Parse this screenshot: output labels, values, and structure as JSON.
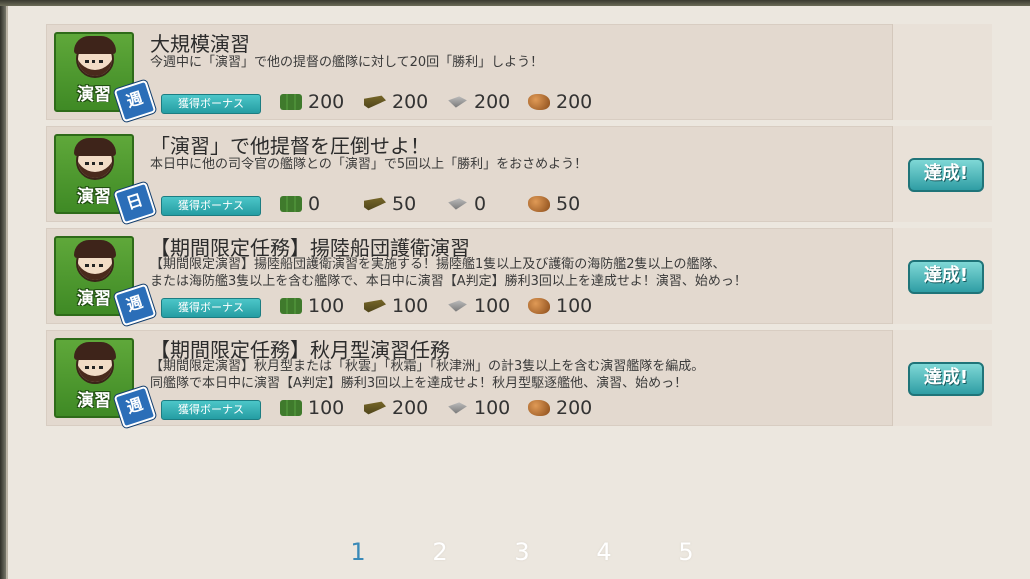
{
  "quests": [
    {
      "badge_label": "演習",
      "frequency": "週",
      "title": "大規模演習",
      "desc": [
        "今週中に「演習」で他の提督の艦隊に対して20回「勝利」しよう！"
      ],
      "bonus_label": "獲得ボーナス",
      "rewards": {
        "fuel": "200",
        "ammo": "200",
        "steel": "200",
        "bauxite": "200"
      },
      "status": ""
    },
    {
      "badge_label": "演習",
      "frequency": "日",
      "title": "「演習」で他提督を圧倒せよ！",
      "desc": [
        "本日中に他の司令官の艦隊との「演習」で5回以上「勝利」をおさめよう！"
      ],
      "bonus_label": "獲得ボーナス",
      "rewards": {
        "fuel": "0",
        "ammo": "50",
        "steel": "0",
        "bauxite": "50"
      },
      "status": "達成!"
    },
    {
      "badge_label": "演習",
      "frequency": "週",
      "title": "【期間限定任務】揚陸船団護衛演習",
      "desc": [
        "【期間限定演習】揚陸船団護衛演習を実施する！揚陸艦1隻以上及び護衛の海防艦2隻以上の艦隊、",
        "または海防艦3隻以上を含む艦隊で、本日中に演習【A判定】勝利3回以上を達成せよ！演習、始めっ！"
      ],
      "bonus_label": "獲得ボーナス",
      "rewards": {
        "fuel": "100",
        "ammo": "100",
        "steel": "100",
        "bauxite": "100"
      },
      "status": "達成!"
    },
    {
      "badge_label": "演習",
      "frequency": "週",
      "title": "【期間限定任務】秋月型演習任務",
      "desc": [
        "【期間限定演習】秋月型または「秋雲」「秋霜」「秋津洲」の計3隻以上を含む演習艦隊を編成。",
        "同艦隊で本日中に演習【A判定】勝利3回以上を達成せよ！秋月型駆逐艦他、演習、始めっ！"
      ],
      "bonus_label": "獲得ボーナス",
      "rewards": {
        "fuel": "100",
        "ammo": "200",
        "steel": "100",
        "bauxite": "200"
      },
      "status": "達成!"
    }
  ],
  "pagination": [
    "1",
    "2",
    "3",
    "4",
    "5"
  ],
  "current_page": "1",
  "colors": {
    "accent": "#2fa0a6",
    "badge_green": "#4a9a2e",
    "page_active": "#3a8ab8"
  }
}
